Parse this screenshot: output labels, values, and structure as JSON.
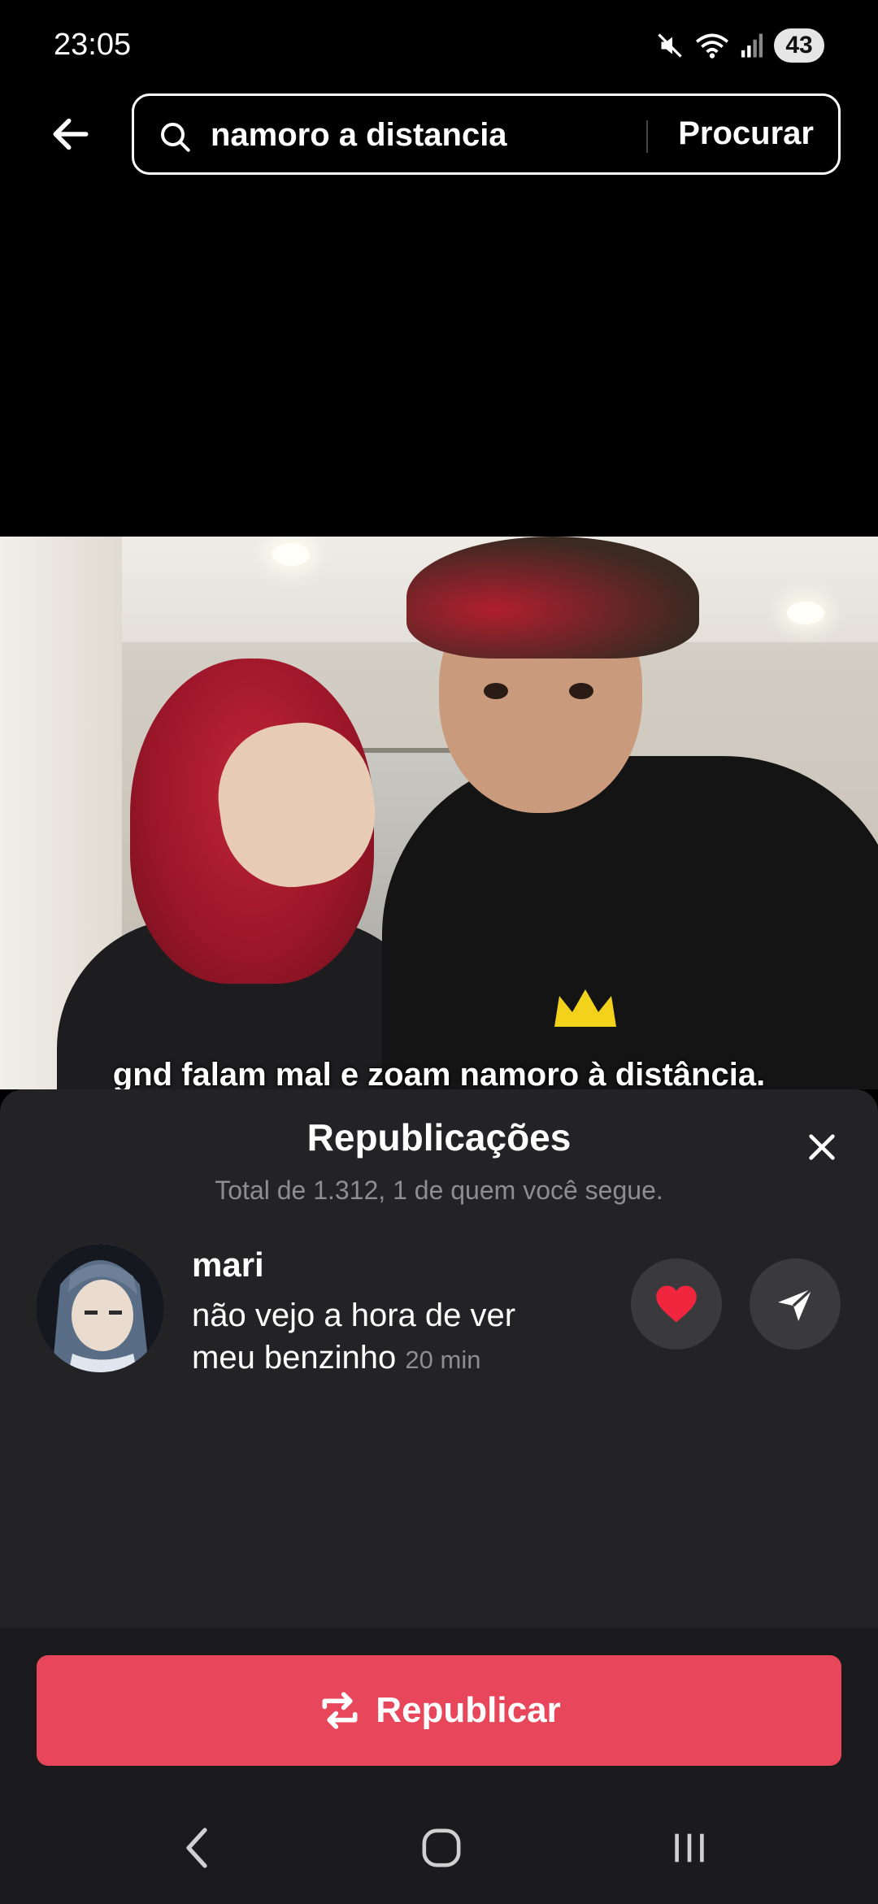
{
  "status_bar": {
    "time": "23:05",
    "battery": "43",
    "icons": [
      "mute-icon",
      "wifi-icon",
      "signal-icon"
    ]
  },
  "search": {
    "query": "namoro a distancia",
    "submit_label": "Procurar"
  },
  "video": {
    "caption": "gnd falam mal e zoam namoro à distância."
  },
  "reposts_sheet": {
    "title": "Republicações",
    "subtitle": "Total de 1.312, 1 de quem você segue.",
    "items": [
      {
        "name": "mari",
        "message": "não vejo a hora de ver meu benzinho",
        "time": "20 min"
      }
    ],
    "repost_button_label": "Republicar"
  },
  "colors": {
    "accent": "#e8465a",
    "sheet_bg": "#232325",
    "muted_text": "#8d8d92"
  }
}
